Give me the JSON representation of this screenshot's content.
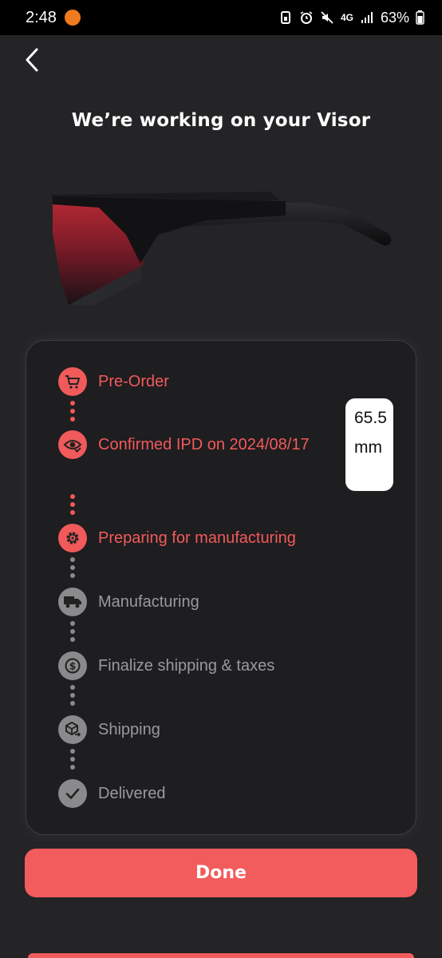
{
  "status_bar": {
    "time": "2:48",
    "network": "4G",
    "battery": "63%"
  },
  "header": {
    "back_icon": "chevron-left-icon",
    "title": "We’re working on your Visor"
  },
  "progress": {
    "steps": [
      {
        "label": "Pre-Order",
        "state": "done",
        "icon": "cart-icon"
      },
      {
        "label": "Confirmed IPD on 2024/08/17",
        "state": "done",
        "icon": "eye-check-icon"
      },
      {
        "label": "Preparing for manufacturing",
        "state": "current",
        "icon": "gear-icon"
      },
      {
        "label": "Manufacturing",
        "state": "pending",
        "icon": "truck-icon"
      },
      {
        "label": "Finalize shipping & taxes",
        "state": "pending",
        "icon": "dollar-coin-icon"
      },
      {
        "label": "Shipping",
        "state": "pending",
        "icon": "box-arrow-icon"
      },
      {
        "label": "Delivered",
        "state": "pending",
        "icon": "check-icon"
      }
    ],
    "ipd_value": "65.5mm"
  },
  "actions": {
    "done_label": "Done"
  },
  "colors": {
    "accent": "#f25c5c",
    "background": "#242326",
    "card": "#1e1d20",
    "inactive": "#8a8a8c"
  }
}
